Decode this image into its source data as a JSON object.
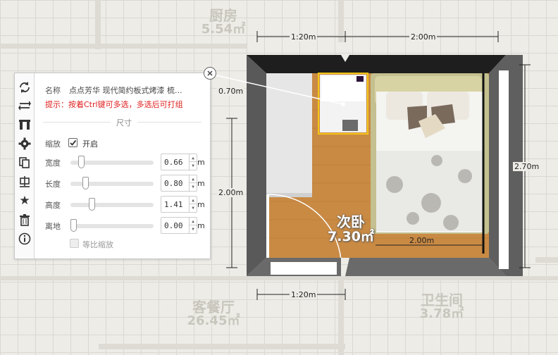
{
  "background_rooms": [
    {
      "name": "厨房",
      "area": "5.54㎡"
    },
    {
      "name": "客餐厅",
      "area": "26.45㎡"
    },
    {
      "name": "卫生间",
      "area": "3.78㎡"
    }
  ],
  "room": {
    "name": "次卧",
    "area": "7.30㎡"
  },
  "dimensions": {
    "top_left": "1:20m",
    "top_right": "2:00m",
    "right": "2.70m",
    "left": "2.00m",
    "bottom_left": "1:20m",
    "bed_width": "2.00m",
    "selected_depth": "0.70m"
  },
  "panel": {
    "name_label": "名称",
    "name_value": "点点芳华 现代简约板式烤漆 梳...",
    "hint": "提示：按着Ctrl键可多选，多选后可打组",
    "section_title": "尺寸",
    "scale_label": "缩放",
    "scale_checked": true,
    "scale_value_label": "开启",
    "rows": [
      {
        "label": "宽度",
        "value": "0.66",
        "unit": "m",
        "level": 0.1
      },
      {
        "label": "长度",
        "value": "0.80",
        "unit": "m",
        "level": 0.16
      },
      {
        "label": "高度",
        "value": "1.41",
        "unit": "m",
        "level": 0.24
      },
      {
        "label": "离地",
        "value": "0.00",
        "unit": "m",
        "level": 0.0
      }
    ],
    "proportional_label": "等比缩放",
    "proportional_checked": false
  },
  "toolbar_icons": [
    "rotate-icon",
    "swap-icon",
    "align-icon",
    "gear-icon",
    "copy-icon",
    "center-icon",
    "star-icon",
    "trash-icon",
    "info-icon"
  ],
  "colors": {
    "wall": "#222222",
    "wall_side": "#5f5f5f",
    "floor": "#c98a44",
    "selection": "#f5c518",
    "hint": "#e02020"
  }
}
